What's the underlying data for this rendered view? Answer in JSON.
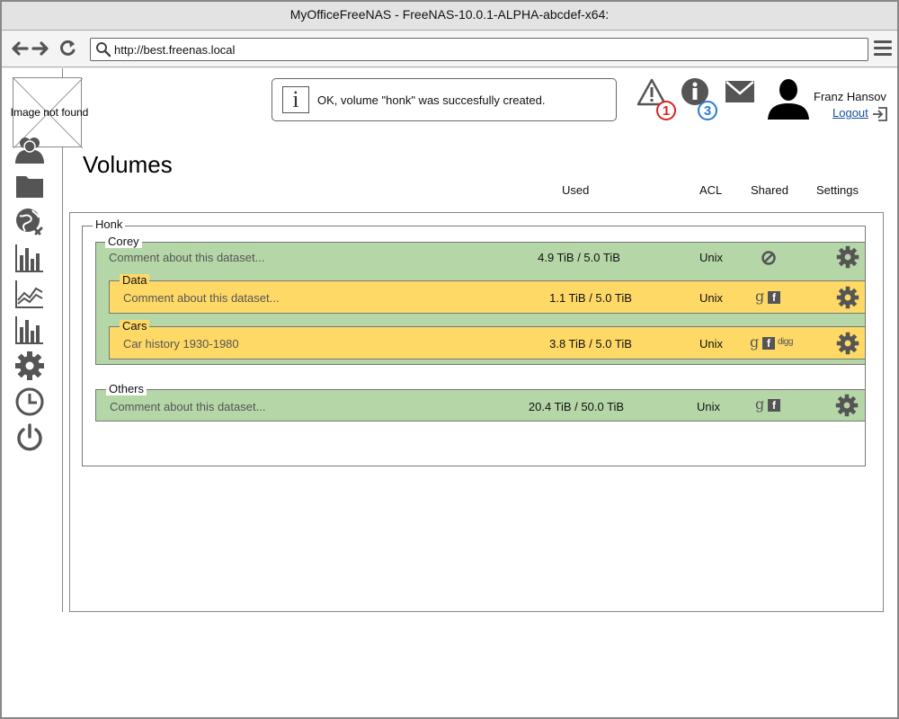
{
  "window": {
    "title": "MyOfficeFreeNAS - FreeNAS-10.0.1-ALPHA-abcdef-x64:"
  },
  "browser": {
    "url": "http://best.freenas.local"
  },
  "logo": {
    "alt": "Image not found"
  },
  "notification": {
    "message": "OK, volume \"honk\" was succesfully created."
  },
  "alerts": {
    "warning_count": "1",
    "info_count": "3"
  },
  "user": {
    "name": "Franz Hansov",
    "logout": "Logout"
  },
  "sidebar_icons": [
    "users-icon",
    "folder-icon",
    "network-icon",
    "bar-chart-icon",
    "line-chart-icon",
    "bar-chart-icon",
    "gear-icon",
    "clock-icon",
    "power-icon"
  ],
  "page": {
    "title": "Volumes"
  },
  "columns": {
    "used": "Used",
    "acl": "ACL",
    "shared": "Shared",
    "settings": "Settings"
  },
  "volume": {
    "name": "Honk",
    "datasets": [
      {
        "name": "Corey",
        "comment": "Comment about this dataset...",
        "used": "4.9 TiB / 5.0 TiB",
        "acl": "Unix",
        "shared": [
          "none"
        ],
        "color": "#b5d7a8",
        "children": [
          {
            "name": "Data",
            "comment": "Comment about this dataset...",
            "used": "1.1 TiB / 5.0 TiB",
            "acl": "Unix",
            "shared": [
              "google",
              "facebook"
            ],
            "color": "#ffd966"
          },
          {
            "name": "Cars",
            "comment": "Car history 1930-1980",
            "used": "3.8 TiB / 5.0 TiB",
            "acl": "Unix",
            "shared": [
              "google",
              "facebook",
              "digg"
            ],
            "color": "#ffd966"
          }
        ]
      },
      {
        "name": "Others",
        "comment": "Comment about this dataset...",
        "used": "20.4 TiB / 50.0 TiB",
        "acl": "Unix",
        "shared": [
          "google",
          "facebook"
        ],
        "color": "#b5d7a8"
      }
    ]
  },
  "share_glyphs": {
    "google": "g",
    "facebook": "f",
    "digg": "digg"
  }
}
